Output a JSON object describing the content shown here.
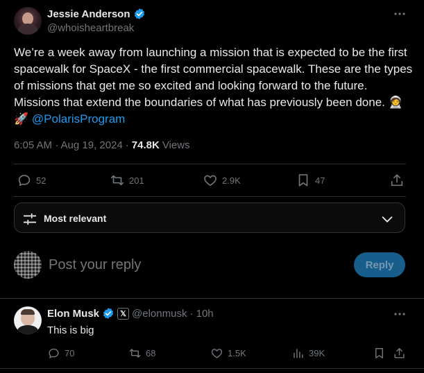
{
  "tweet": {
    "author_name": "Jessie Anderson",
    "author_handle": "@whoisheartbreak",
    "text_main": "We’re a week away from launching a mission that is expected to be the first spacewalk for SpaceX - the first commercial spacewalk. These are the types of missions that get me so excited and looking forward to the future. Missions that extend the boundaries of what has previously been done. 🧑‍🚀🚀",
    "mention": "@PolarisProgram",
    "time": "6:05 AM · Aug 19, 2024",
    "separator": "·",
    "views_count": "74.8K",
    "views_label": "Views",
    "replies": "52",
    "reposts": "201",
    "likes": "2.9K",
    "bookmarks": "47"
  },
  "sort": {
    "label": "Most relevant"
  },
  "compose": {
    "placeholder": "Post your reply",
    "reply_button": "Reply"
  },
  "reply": {
    "author_name": "Elon Musk",
    "author_handle": "@elonmusk",
    "time": "· 10h",
    "text": "This is big",
    "replies": "70",
    "reposts": "68",
    "likes": "1.5K",
    "views": "39K"
  },
  "colors": {
    "accent": "#1d9bf0",
    "background": "#000000",
    "text": "#e7e9ea",
    "muted": "#71767b",
    "border": "#2f3336"
  }
}
